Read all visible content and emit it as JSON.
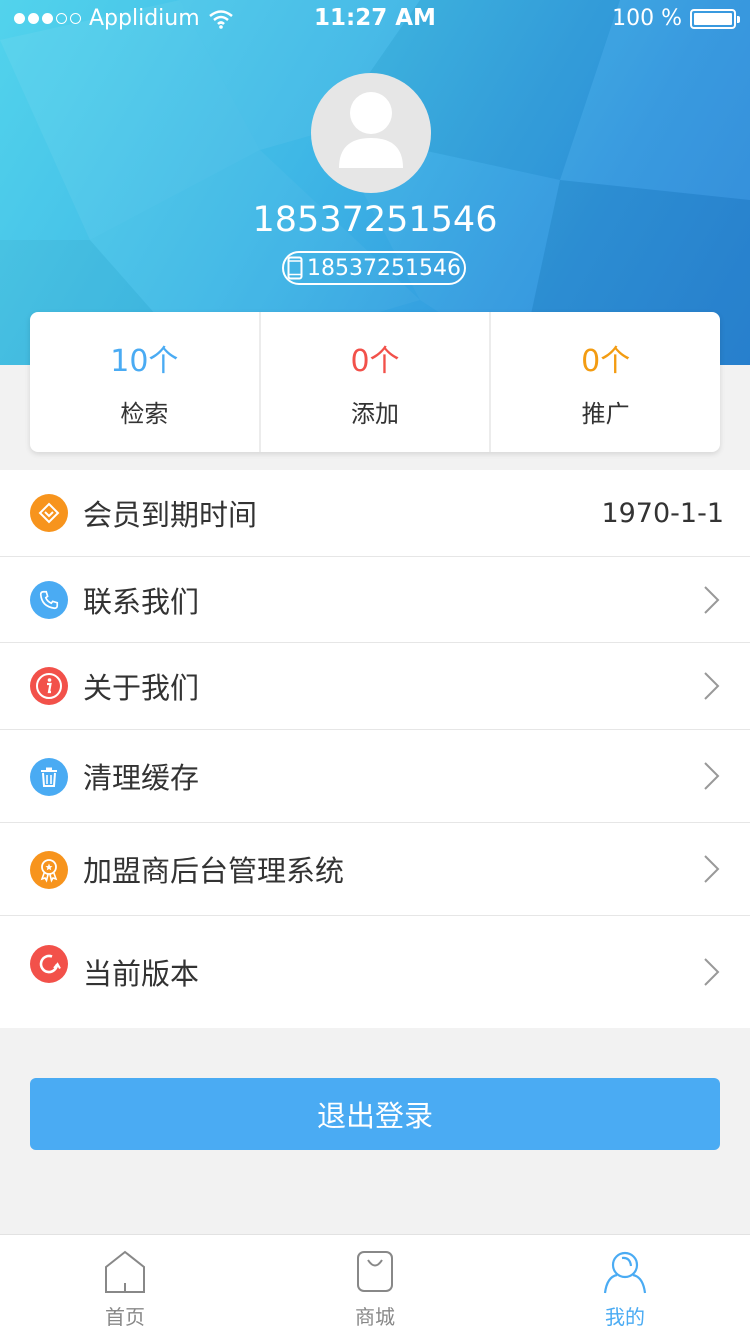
{
  "status_bar": {
    "carrier": "Applidium",
    "time": "11:27 AM",
    "battery": "100 %"
  },
  "profile": {
    "username": "18537251546",
    "phone": "18537251546"
  },
  "stats": [
    {
      "value": "10个",
      "label": "检索",
      "color": "#4aabf3"
    },
    {
      "value": "0个",
      "label": "添加",
      "color": "#f2514a"
    },
    {
      "value": "0个",
      "label": "推广",
      "color": "#f39c12"
    }
  ],
  "menu": {
    "membership": {
      "label": "会员到期时间",
      "value": "1970-1-1",
      "icon": "diamond-icon",
      "color": "#f7941d"
    },
    "contact": {
      "label": "联系我们",
      "icon": "phone-icon",
      "color": "#4aabf3"
    },
    "about": {
      "label": "关于我们",
      "icon": "info-icon",
      "color": "#f2514a"
    },
    "cache": {
      "label": "清理缓存",
      "icon": "trash-icon",
      "color": "#4aabf3"
    },
    "franchise": {
      "label": "加盟商后台管理系统",
      "icon": "medal-icon",
      "color": "#f7941d"
    },
    "version": {
      "label": "当前版本",
      "icon": "refresh-icon",
      "color": "#f2514a"
    }
  },
  "logout_label": "退出登录",
  "tabbar": {
    "home": "首页",
    "shop": "商城",
    "mine": "我的",
    "active_color": "#4aabf3"
  }
}
